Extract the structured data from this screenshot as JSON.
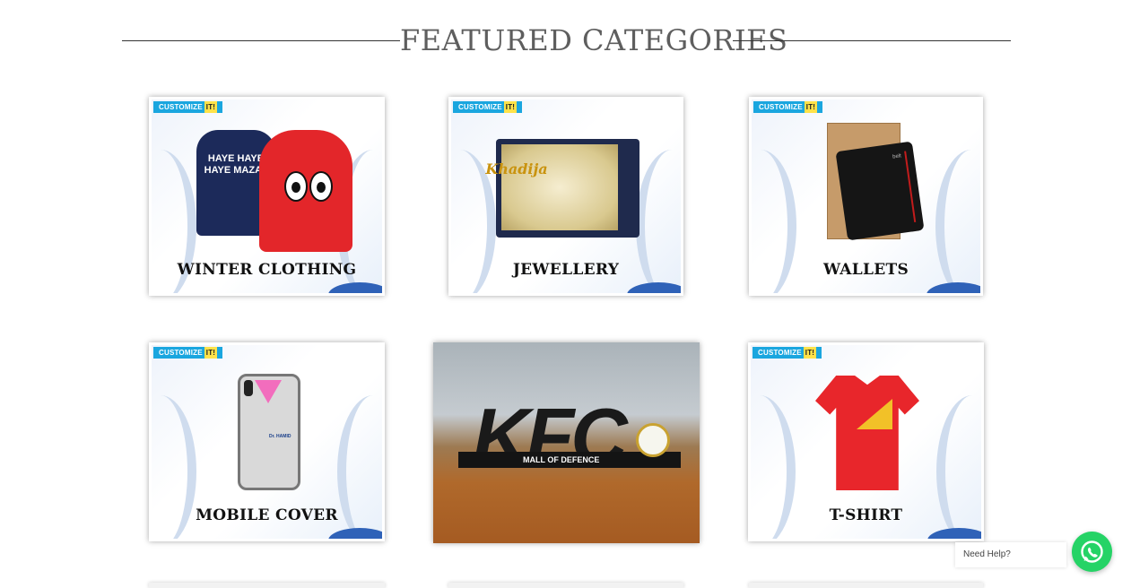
{
  "section": {
    "title": "FEATURED CATEGORIES"
  },
  "badge": {
    "prefix": "CUSTOMIZE",
    "suffix": "IT!"
  },
  "categories": [
    {
      "label": "WINTER CLOTHING",
      "art_text": "HAYE HAYE HAYE MAZAY"
    },
    {
      "label": "JEWELLERY",
      "art_text": "Khadija"
    },
    {
      "label": "WALLETS",
      "art_text": "belt"
    },
    {
      "label": "MOBILE COVER",
      "art_text": "Dr. HAMID"
    },
    {
      "label": "",
      "art_text": "KFC",
      "art_subtext": "MALL OF DEFENCE"
    },
    {
      "label": "T-SHIRT",
      "art_text": ""
    }
  ],
  "whatsapp": {
    "help_text": "Need Help?",
    "brand_color": "#25d366"
  }
}
